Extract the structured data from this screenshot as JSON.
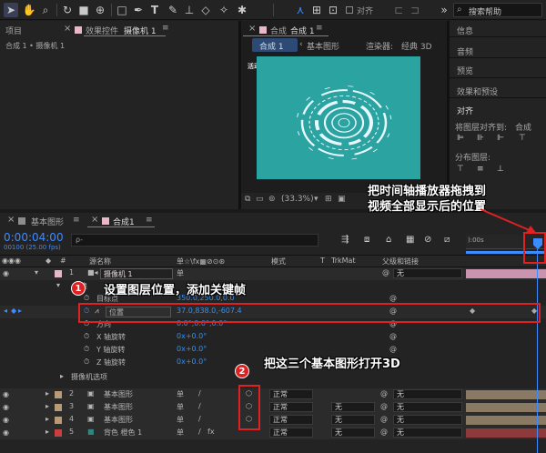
{
  "toolbar": {
    "snap_label": "对齐",
    "search_placeholder": "搜索帮助"
  },
  "project_panel": {
    "tab_project": "项目",
    "tab_effects": "效果控件",
    "effects_target": "摄像机 1",
    "breadcrumb": "合成 1 • 摄像机 1"
  },
  "comp_panel": {
    "tab_label": "合成",
    "tab_name": "合成 1",
    "subtab_comp": "合成 1",
    "subtab_shape": "基本图形",
    "renderer_label": "渲染器:",
    "renderer_value": "经典 3D",
    "active_camera": "活动摄像机",
    "zoom": "(33.3%)"
  },
  "right_panel": {
    "items": [
      "信息",
      "音频",
      "预览",
      "效果和预设",
      "对齐"
    ],
    "align_to_label": "将图层对齐到:",
    "align_to_value": "合成",
    "distribute_label": "分布图层:"
  },
  "timeline": {
    "tab_shape": "基本图形",
    "tab_comp": "合成1",
    "timecode": "0:00:04:00",
    "frame_info": "00100 (25.00 fps)",
    "search_placeholder": "ρ-",
    "ruler_start": "):00s",
    "headers": {
      "num": "#",
      "source_name": "源名称",
      "switches": "单☆\\fx▦⊘⊙⊛",
      "mode": "模式",
      "t": "T",
      "trkmat": "TrkMat",
      "parent": "父级和链接"
    },
    "camera_layer": {
      "num": "1",
      "name": "摄像机 1",
      "sw": "单",
      "parent": "无"
    },
    "transform": "变换",
    "props": [
      {
        "name": "目标点",
        "value": "350.0,250.0,0.0"
      },
      {
        "name": "位置",
        "value": "37.0,838.0,-607.4"
      },
      {
        "name": "方向",
        "value": "0.0°,0.0°,0.0°"
      },
      {
        "name": "X 轴旋转",
        "value": "0x+0.0°"
      },
      {
        "name": "Y 轴旋转",
        "value": "0x+0.0°"
      },
      {
        "name": "Z 轴旋转",
        "value": "0x+0.0°"
      }
    ],
    "camera_options": "摄像机选项",
    "layers": [
      {
        "num": "2",
        "name": "基本图形",
        "sw": "单",
        "mode": "正常",
        "trkmat": "",
        "parent": "无",
        "color": "#b69b74"
      },
      {
        "num": "3",
        "name": "基本图形",
        "sw": "单",
        "mode": "正常",
        "trkmat": "无",
        "parent": "无",
        "color": "#b69b74"
      },
      {
        "num": "4",
        "name": "基本图形",
        "sw": "单",
        "mode": "正常",
        "trkmat": "无",
        "parent": "无",
        "color": "#b69b74"
      },
      {
        "num": "5",
        "name": "背色 橙色 1",
        "sw": "单",
        "mode": "正常",
        "trkmat": "无",
        "parent": "无",
        "color": "#c64040"
      }
    ]
  },
  "annotations": {
    "playhead_note_1": "把时间轴播放器拖拽到",
    "playhead_note_2": "视频全部显示后的位置",
    "badge1": "1",
    "note1": "设置图层位置，添加关键帧",
    "badge2": "2",
    "note2": "把这三个基本图形打开3D"
  },
  "colors": {
    "accent": "#3c8bff",
    "comp_bg": "#2aa3a1",
    "annotation": "#e02121",
    "camera_label": "#d77fb3"
  }
}
